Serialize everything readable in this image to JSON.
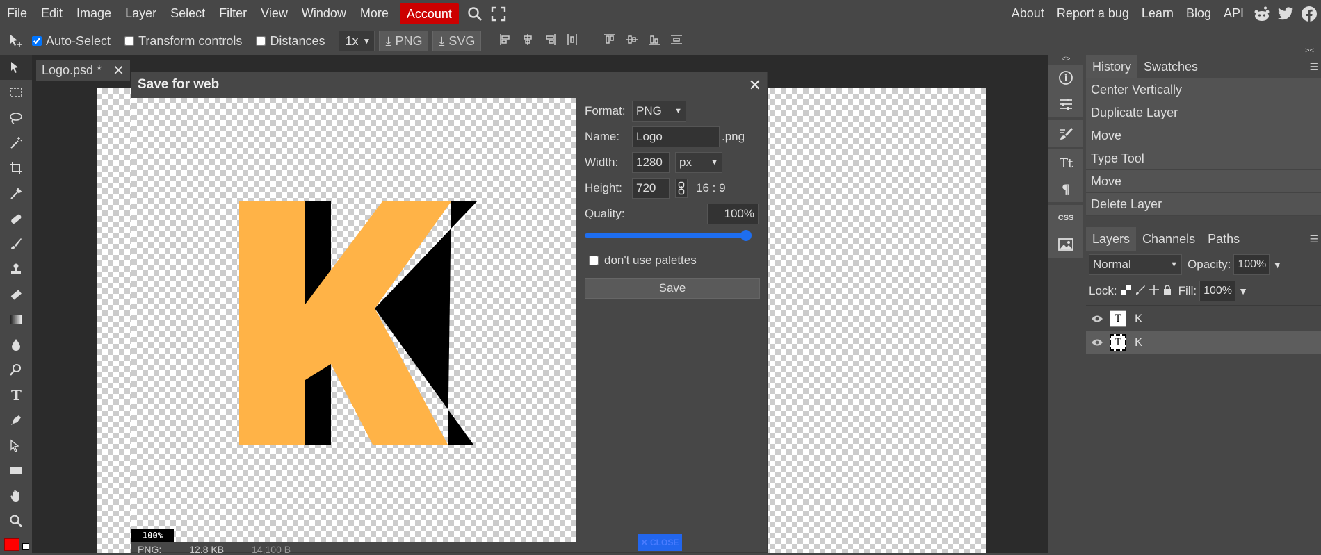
{
  "menubar": {
    "items": [
      "File",
      "Edit",
      "Image",
      "Layer",
      "Select",
      "Filter",
      "View",
      "Window",
      "More"
    ],
    "account": "Account",
    "right": [
      "About",
      "Report a bug",
      "Learn",
      "Blog",
      "API"
    ]
  },
  "options": {
    "auto_select": "Auto-Select",
    "transform_controls": "Transform controls",
    "distances": "Distances",
    "scale": "1x",
    "png": "PNG",
    "svg": "SVG"
  },
  "document": {
    "tab": "Logo.psd *"
  },
  "dialog": {
    "title": "Save for web",
    "format_label": "Format:",
    "format_value": "PNG",
    "name_label": "Name:",
    "name_value": "Logo",
    "ext": ".png",
    "width_label": "Width:",
    "width_value": "1280",
    "unit": "px",
    "height_label": "Height:",
    "height_value": "720",
    "ratio": "16 : 9",
    "quality_label": "Quality:",
    "quality_value": "100%",
    "quality": 1.0,
    "palette_label": "don't use palettes",
    "save": "Save",
    "zoom": "100%",
    "status_format": "PNG:",
    "status_size": "12.8 KB",
    "status_extra": "14,100 B",
    "close_badge": "✕ CLOSE"
  },
  "colors": {
    "letter": "#ffb347",
    "shadow": "#000000",
    "accent": "#1e6ef0",
    "account": "#cc0000",
    "foreground": "#ff0000"
  },
  "history": {
    "tabs": [
      "History",
      "Swatches"
    ],
    "items": [
      "Center Vertically",
      "Duplicate Layer",
      "Move",
      "Type Tool",
      "Move",
      "Delete Layer"
    ]
  },
  "layers": {
    "tabs": [
      "Layers",
      "Channels",
      "Paths"
    ],
    "blend": "Normal",
    "opacity_label": "Opacity:",
    "opacity": "100%",
    "lock_label": "Lock:",
    "fill_label": "Fill:",
    "fill": "100%",
    "items": [
      {
        "name": "K",
        "thumb": "T"
      },
      {
        "name": "K",
        "thumb": "T"
      }
    ]
  },
  "strip": {
    "css": "CSS"
  }
}
